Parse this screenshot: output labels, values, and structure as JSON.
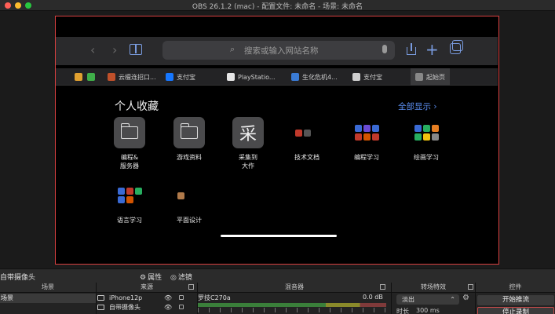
{
  "window": {
    "title": "OBS 26.1.2 (mac) - 配置文件: 未命名 - 场景: 未命名"
  },
  "safari": {
    "search_placeholder": "搜索或输入网站名称",
    "tabs": [
      {
        "label": "",
        "color": "#e0a030"
      },
      {
        "label": "",
        "color": "#3fae49"
      },
      {
        "label": "云檀连招口...",
        "color": "#c0502a"
      },
      {
        "label": "支付宝",
        "color": "#1677ff"
      },
      {
        "label": "PlayStatio...",
        "color": "#e6e6e6"
      },
      {
        "label": "生化危机4...",
        "color": "#3a7bd5"
      },
      {
        "label": "支付宝",
        "color": "#d0d0d0"
      },
      {
        "label": "起始页",
        "color": "#888888"
      }
    ],
    "favorites_title": "个人收藏",
    "show_all": "全部显示 ›",
    "favorites": [
      {
        "label": "编程&\n服务器",
        "icon": "folder-icon"
      },
      {
        "label": "游戏资料",
        "icon": "folder-icon"
      },
      {
        "label": "采集到\n大作",
        "icon": "cai-icon",
        "glyph": "采"
      },
      {
        "label": "技术文档",
        "icon": "mini-grid-icon"
      },
      {
        "label": "编程学习",
        "icon": "mini-grid-icon"
      },
      {
        "label": "绘画学习",
        "icon": "mini-grid-icon"
      },
      {
        "label": "语言学习",
        "icon": "mini-grid-icon"
      },
      {
        "label": "平面设计",
        "icon": "mini-grid-icon"
      }
    ]
  },
  "obs": {
    "selected_source": "自带摄像头",
    "properties_label": "属性",
    "filters_label": "滤镜",
    "panels": {
      "scenes": "场景",
      "sources": "来源",
      "mixer": "混音器",
      "transitions": "转场特效",
      "controls": "控件"
    },
    "scene_item": "场景",
    "sources_list": [
      {
        "name": "iPhone12p"
      },
      {
        "name": "自带摄像头"
      },
      {
        "name": ""
      }
    ],
    "mixer": {
      "device": "罗技C270a",
      "db": "0.0 dB"
    },
    "transition": {
      "type": "淡出",
      "duration_label": "时长",
      "duration_value": "300 ms"
    },
    "controls": {
      "start_stream": "开始推流",
      "stop_record": "停止录制"
    },
    "colors": {
      "record_border": "#d94040",
      "accent_link": "#5b8ef0"
    }
  }
}
